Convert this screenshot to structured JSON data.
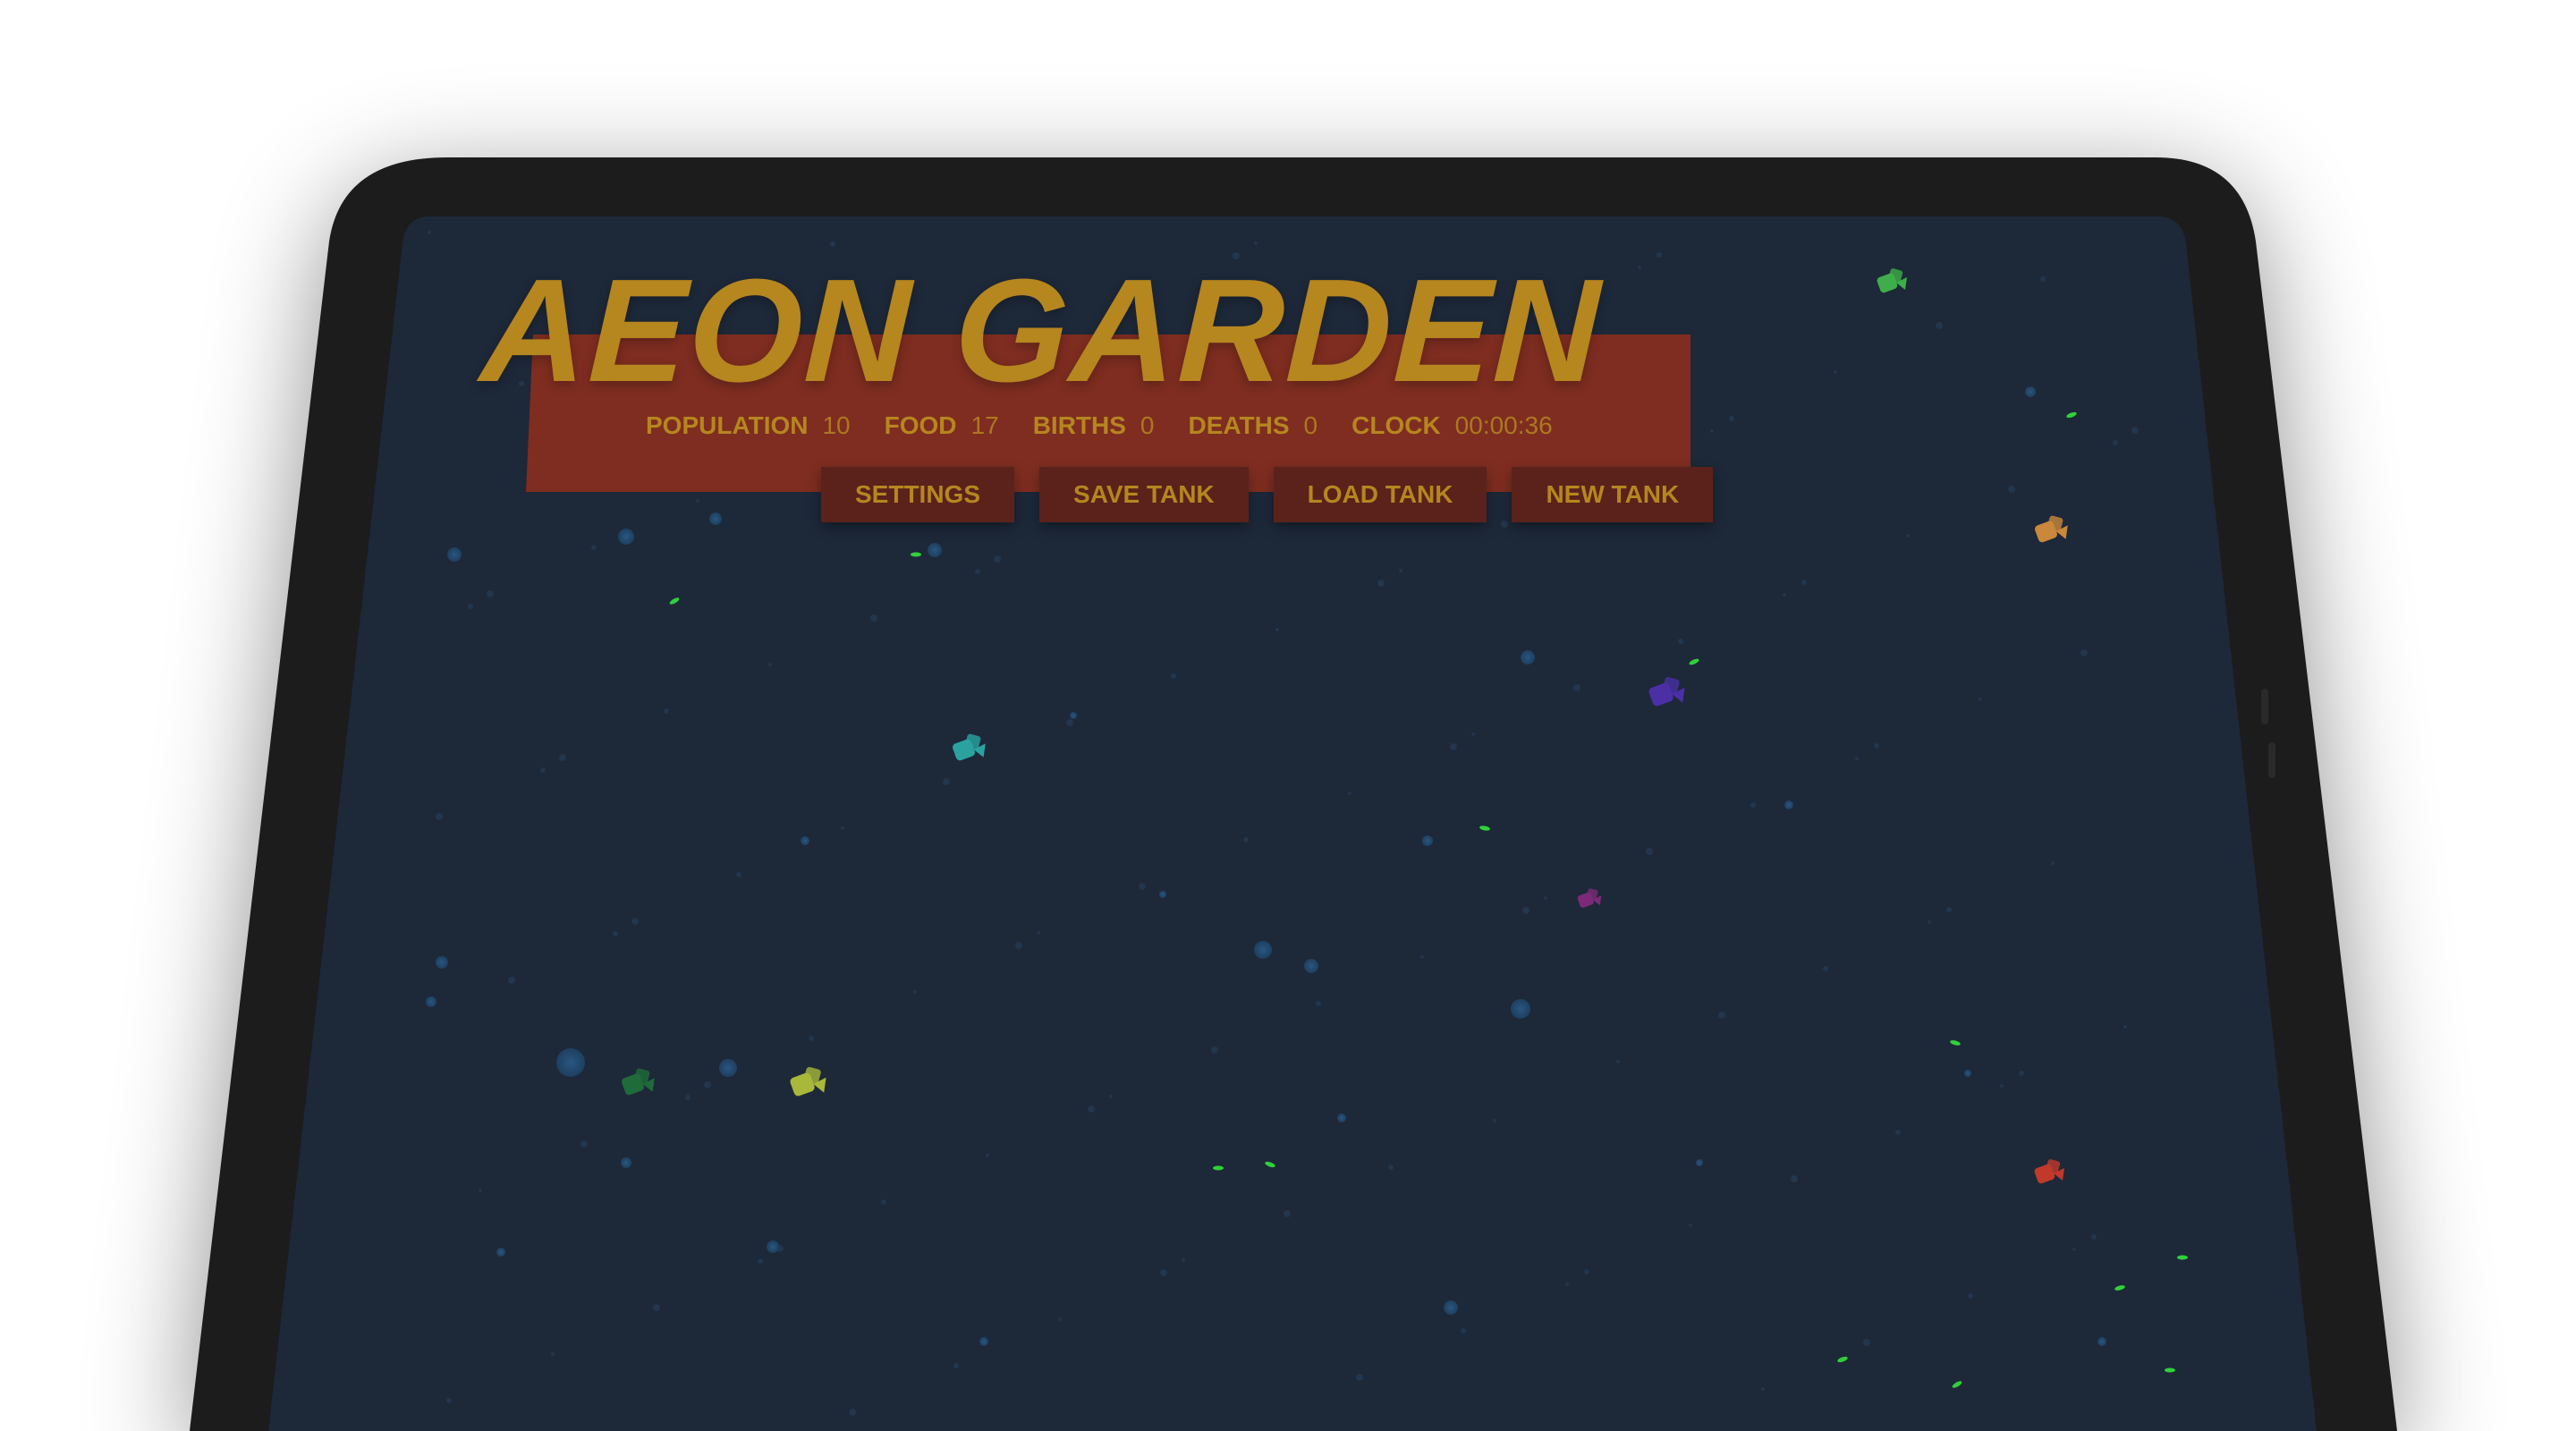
{
  "app": {
    "title": "AEON GARDEN"
  },
  "stats": [
    {
      "label": "POPULATION",
      "value": "10"
    },
    {
      "label": "FOOD",
      "value": "17"
    },
    {
      "label": "BIRTHS",
      "value": "0"
    },
    {
      "label": "DEATHS",
      "value": "0"
    },
    {
      "label": "CLOCK",
      "value": "00:00:36"
    }
  ],
  "buttons": {
    "settings": "SETTINGS",
    "save_tank": "SAVE TANK",
    "load_tank": "LOAD TANK",
    "new_tank": "NEW TANK"
  },
  "colors": {
    "accent_gold": "#b6861f",
    "banner_red": "#7e2d20",
    "button_maroon": "#5a221b",
    "tank_water": "#1d2839",
    "device_bezel": "#1c1c1c"
  },
  "creatures": [
    {
      "name": "green-creature",
      "color": "#3fae4a"
    },
    {
      "name": "orange-creature",
      "color": "#c9883a"
    },
    {
      "name": "purple-creature",
      "color": "#4a2fa5"
    },
    {
      "name": "teal-creature",
      "color": "#2aa3a0"
    },
    {
      "name": "magenta-creature",
      "color": "#7a2a78"
    },
    {
      "name": "dark-green-creature",
      "color": "#1f6b3a"
    },
    {
      "name": "yellow-green-creature",
      "color": "#a8b83a"
    },
    {
      "name": "red-creature",
      "color": "#c0392b"
    }
  ]
}
